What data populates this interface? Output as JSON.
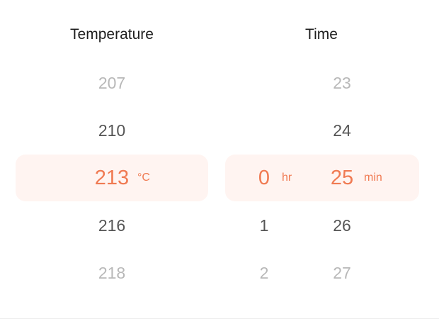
{
  "temperature": {
    "title": "Temperature",
    "unit": "°C",
    "values": [
      "207",
      "210",
      "213",
      "216",
      "218"
    ],
    "selected_index": 2
  },
  "time": {
    "title": "Time",
    "hours": {
      "unit": "hr",
      "values": [
        "",
        "",
        "0",
        "1",
        "2"
      ],
      "selected_index": 2
    },
    "minutes": {
      "unit": "min",
      "values": [
        "23",
        "24",
        "25",
        "26",
        "27"
      ],
      "selected_index": 2
    }
  },
  "colors": {
    "accent": "#f07a52",
    "highlight_bg": "#fff4f1",
    "text_near": "#555555",
    "text_far": "#b8b8b8",
    "title": "#1e1e1e"
  }
}
